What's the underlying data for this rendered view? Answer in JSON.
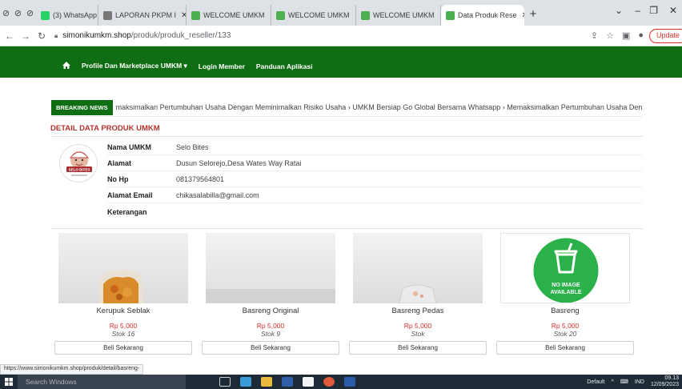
{
  "browser": {
    "tabs": [
      {
        "title": "(3) WhatsApp",
        "color": "#25d366"
      },
      {
        "title": "LAPORAN PKPM I",
        "color": "#777777"
      },
      {
        "title": "WELCOME UMKM",
        "color": "#4caf50"
      },
      {
        "title": "WELCOME UMKM",
        "color": "#4caf50"
      },
      {
        "title": "WELCOME UMKM",
        "color": "#4caf50"
      },
      {
        "title": "Data Produk Rese",
        "color": "#4caf50"
      }
    ],
    "url_host": "simonikumkm.shop",
    "url_path": "/produk/produk_reseller/133",
    "update_label": "Update"
  },
  "nav": {
    "items": [
      "Profile Dan Marketplace UMKM ▾",
      "Login Member",
      "Panduan Aplikasi"
    ]
  },
  "news": {
    "label": "BREAKING NEWS",
    "ticker": "maksimalkan Pertumbuhan Usaha Dengan Meminimalkan Risiko Usaha  ›  UMKM Bersiap Go Global Bersama Whatsapp  ›  Memaksimalkan Pertumbuhan Usaha Dengan Meminir"
  },
  "detail": {
    "title": "DETAIL DATA PRODUK UMKM",
    "logo_text": "SELO BITES",
    "rows": [
      {
        "label": "Nama UMKM",
        "value": "Selo Bites"
      },
      {
        "label": "Alamat",
        "value": "Dusun Selorejo,Desa Wates Way Ratai"
      },
      {
        "label": "No Hp",
        "value": "081379564801"
      },
      {
        "label": "Alamat Email",
        "value": "chikasalabilla@gmail.com"
      },
      {
        "label": "Keterangan",
        "value": ""
      }
    ]
  },
  "products": [
    {
      "name": "Kerupuk Seblak",
      "price": "Rp 5,000",
      "stock": "Stok 16",
      "button": "Beli Sekarang"
    },
    {
      "name": "Basreng Original",
      "price": "Rp 5,000",
      "stock": "Stok 9",
      "button": "Beli Sekarang"
    },
    {
      "name": "Basreng Pedas",
      "price": "Rp 5,000",
      "stock": "Stok",
      "button": "Beli Sekarang"
    },
    {
      "name": "Basreng",
      "price": "Rp 5,000",
      "stock": "Stok 20",
      "button": "Beli Sekarang",
      "noimage": "NO IMAGE\nAVAILABLE"
    }
  ],
  "status_url": "https://www.simonikumkm.shop/produk/detail/basreng-",
  "taskbar": {
    "search": "Search Windows",
    "tray_default": "Default",
    "lang": "IND",
    "time": "09.13",
    "date": "12/09/2023"
  }
}
